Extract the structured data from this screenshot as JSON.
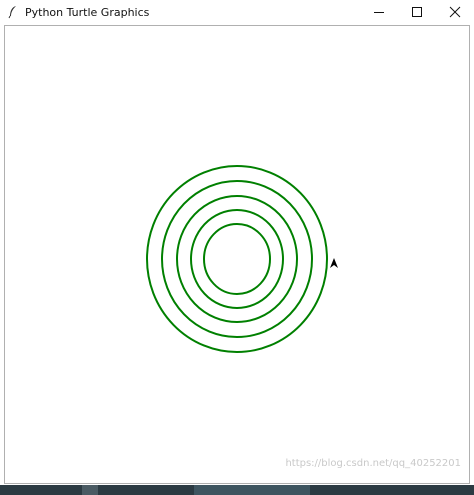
{
  "window": {
    "title": "Python Turtle Graphics"
  },
  "icons": {
    "app": "feather-icon",
    "minimize": "minimize-icon",
    "maximize": "maximize-icon",
    "close": "close-icon",
    "turtle": "arrow-cursor-icon"
  },
  "drawing": {
    "ring_count": 5,
    "pen_color": "#008000"
  },
  "watermark": {
    "text": "https://blog.csdn.net/qq_40252201"
  }
}
